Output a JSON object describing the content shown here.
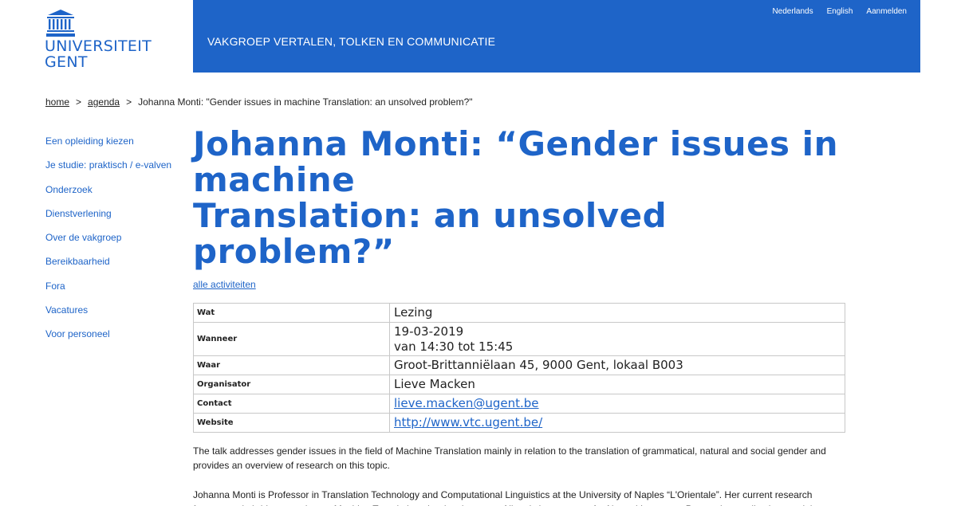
{
  "logo": {
    "line1": "UNIVERSITEIT",
    "line2": "GENT",
    "icon": "university-building-icon"
  },
  "header": {
    "department": "VAKGROEP VERTALEN, TOLKEN EN COMMUNICATIE",
    "links": [
      "Nederlands",
      "English",
      "Aanmelden"
    ]
  },
  "breadcrumb": {
    "home": "home",
    "separator": ">",
    "agenda": "agenda",
    "current": "Johanna Monti: \"Gender issues in machine Translation: an unsolved problem?\""
  },
  "sidebar": {
    "items": [
      "Een opleiding kiezen",
      "Je studie: praktisch / e-valven",
      "Onderzoek",
      "Dienstverlening",
      "Over de vakgroep",
      "Bereikbaarheid",
      "Fora",
      "Vacatures",
      "Voor personeel"
    ]
  },
  "main": {
    "title_line1": "Johanna Monti: “Gender issues in machine",
    "title_line2": "Translation: an unsolved problem?”",
    "all_activities": "alle activiteiten",
    "info": {
      "wat_label": "Wat",
      "wat_value": "Lezing",
      "wanneer_label": "Wanneer",
      "wanneer_date": "19-03-2019",
      "wanneer_time": "van 14:30 tot 15:45",
      "waar_label": "Waar",
      "waar_value": "Groot-Brittanniëlaan 45, 9000 Gent, lokaal B003",
      "organisator_label": "Organisator",
      "organisator_value": "Lieve Macken",
      "contact_label": "Contact",
      "contact_value": "lieve.macken@ugent.be",
      "website_label": "Website",
      "website_value": "http://www.vtc.ugent.be/"
    },
    "paragraph1": "The talk addresses gender issues in the field of Machine Translation mainly in relation to the translation of grammatical, natural and social gender and provides an overview of research on this topic.",
    "paragraph2": "Johanna Monti is Professor in Translation Technology and Computational Linguistics at the University of Naples “L'Orientale”. Her current research focuses on hybrid approaches to Machine Translation, the development of linguistic resources for Natural Language Processing applications and the evaluation of Translation Technology."
  },
  "colors": {
    "brand": "#1e64c8",
    "text": "#222222",
    "border": "#c8c8c8"
  }
}
